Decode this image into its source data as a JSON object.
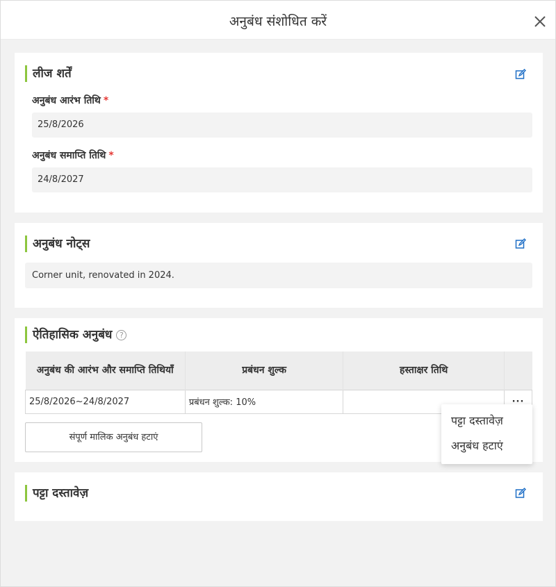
{
  "modal": {
    "title": "अनुबंध संशोधित करें",
    "close_label": "×"
  },
  "lease_terms": {
    "title": "लीज शर्तें",
    "start_label": "अनुबंध आरंभ तिथि",
    "start_value": "25/8/2026",
    "end_label": "अनुबंध समाप्ति तिथि",
    "end_value": "24/8/2027",
    "required_mark": "*"
  },
  "notes": {
    "title": "अनुबंध नोट्स",
    "value": "Corner unit, renovated in 2024."
  },
  "history": {
    "title": "ऐतिहासिक अनुबंध",
    "help": "?",
    "columns": [
      "अनुबंध की आरंभ और समाप्ति तिथियाँ",
      "प्रबंधन शुल्क",
      "हस्ताक्षर तिथि",
      ""
    ],
    "rows": [
      {
        "dates": "25/8/2026~24/8/2027",
        "fee": "प्रबंधन शुल्क: 10%",
        "signed": "",
        "more": "···"
      }
    ],
    "remove_all_button": "संपूर्ण मालिक अनुबंध हटाएं"
  },
  "dropdown": {
    "items": [
      "पट्टा दस्तावेज़",
      "अनुबंध हटाएं"
    ]
  },
  "documents": {
    "title": "पट्टा दस्तावेज़"
  },
  "colors": {
    "accent": "#8dc63f",
    "link": "#1e6fc6",
    "required": "#e53935"
  }
}
